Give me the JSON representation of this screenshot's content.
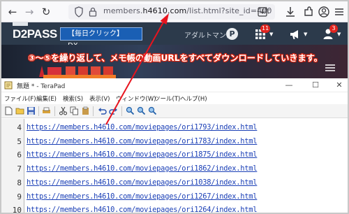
{
  "browser": {
    "url_prefix": "members.",
    "url_domain": "h4610.com",
    "url_path": "/list.html?site_id=400",
    "icons": [
      "back-icon",
      "forward-icon",
      "reload-icon",
      "shield-icon",
      "lock-icon",
      "download-icon",
      "star-icon",
      "download-toolbar-icon",
      "extensions-icon",
      "account-icon",
      "menu-icon"
    ]
  },
  "site": {
    "logo": "D2PASS",
    "daily_button": "【毎日クリック】 DX...",
    "nav_text": "アダルトマンガ",
    "point_label": "P",
    "grid_badge": "11",
    "user_badge": "3"
  },
  "callout": {
    "text": "③～⑤を繰り返して、メモ帳の動画URLをすべてダウンロードしていきます。",
    "color": "#e0230d"
  },
  "terapad": {
    "title": "無題 * - TeraPad",
    "menu": [
      "ファイル(F)",
      "編集(E)",
      "検索(S)",
      "表示(V)",
      "ウィンドウ(W)",
      "ツール(T)",
      "ヘルプ(H)"
    ],
    "lines": [
      {
        "num": "4",
        "text": "https://members.h4610.com/moviepages/ori1793/index.html"
      },
      {
        "num": "5",
        "text": "https://members.h4610.com/moviepages/ori1783/index.html"
      },
      {
        "num": "6",
        "text": "https://members.h4610.com/moviepages/ori1875/index.html"
      },
      {
        "num": "7",
        "text": "https://members.h4610.com/moviepages/ori1862/index.html"
      },
      {
        "num": "8",
        "text": "https://members.h4610.com/moviepages/ori1038/index.html"
      },
      {
        "num": "9",
        "text": "https://members.h4610.com/moviepages/ori1267/index.html"
      },
      {
        "num": "10",
        "text": "https://members.h4610.com/moviepages/ori1264/index.html"
      }
    ]
  },
  "colors": {
    "accent_arrow": "#e8141e",
    "link": "#1a3fb6",
    "header_bg": "#2c3a4b"
  }
}
